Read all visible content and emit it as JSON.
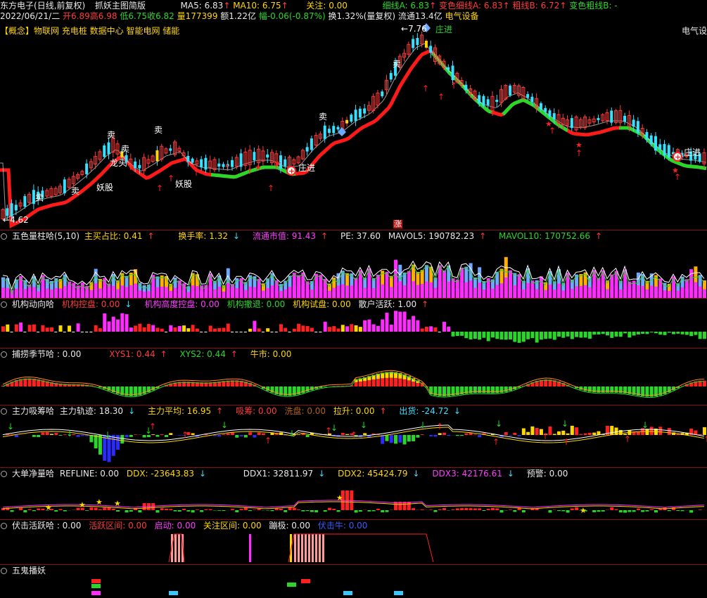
{
  "header": {
    "stock_name": "东方电子",
    "period": "(日线,前复权)",
    "indicator": "抓妖主图简版",
    "ma5": "MA5: 6.83",
    "ma10": "MA10: 6.75",
    "focus": "关注: 0.00",
    "thin_a": "细线A: 6.83",
    "thin_b": "变色细线A: 6.83",
    "thick_b": "粗线B: 6.72",
    "thick_c": "变色粗线B: -",
    "date": "2022/06/21/二",
    "open": "开6.89",
    "high": "高6.98",
    "low": "低6.75",
    "close": "收6.82",
    "volume": "量177399",
    "amount": "额1.22亿",
    "change": "幅-0.06(-0.87%)",
    "turnover": "换1.32%(量复权)",
    "float_cap": "流通13.4亿",
    "sector": "电气设备"
  },
  "concept": {
    "tag": "【概念】",
    "items": "物联网 充电桩 数据中心 智能电网 储能",
    "sector_right": "电气设"
  },
  "main_chart": {
    "price_high_label": "7.76",
    "price_low_label": "4.62",
    "high_arrow": "←",
    "low_arrow": "←",
    "zhang_label": "涨",
    "annotations": {
      "sell": "卖",
      "dragon": "龙头",
      "demon": "妖股",
      "zhuangjin": "庄进"
    }
  },
  "panel_volume": {
    "title": "五色量柱哈(5,10)",
    "buy_ratio": "主买占比: 0.41",
    "turnover": "换手率: 1.32",
    "float_value": "流通市值: 91.43",
    "pe": "PE: 37.60",
    "mavol5": "MAVOL5: 190782.23",
    "mavol10": "MAVOL10: 170752.66"
  },
  "panel_inst": {
    "title": "机构动向哈",
    "control": "机构控盘: 0.00",
    "high_control": "机构高度控盘: 0.00",
    "retreat": "机构撤退: 0.00",
    "trial": "机构试盘: 0.00",
    "retail": "散户活跃: 1.00"
  },
  "panel_season": {
    "title": "捕捞季节哈 : 0.00",
    "xys1": "XYS1: 0.44",
    "xys2": "XYS2: 0.44",
    "bull": "牛市: 0.00"
  },
  "panel_main": {
    "title": "主力吸筹哈",
    "track": "主力轨迹: 18.30",
    "avg": "主力平均: 16.95",
    "absorb": "吸筹: 0.00",
    "wash": "洗盘: 0.00",
    "pull": "拉升: 0.00",
    "ship": "出货: -24.72"
  },
  "panel_ddx": {
    "title": "大单净量哈",
    "refline": "REFLINE: 0.00",
    "ddx": "DDX: -23643.83",
    "ddx1": "DDX1: 32811.97",
    "ddx2": "DDX2: 45424.79",
    "ddx3": "DDX3: 42176.61",
    "warn": "预警: 0.00"
  },
  "panel_ambush": {
    "title": "伏击活跃哈 : 0.00",
    "active": "活跃区间: 0.00",
    "start": "启动: 0.00",
    "focus": "关注区间: 0.00",
    "hidden": "蹦极: 0.00",
    "ambush_bull": "伏击牛: 0.00"
  },
  "panel_ghost": {
    "title": "五鬼播妖"
  },
  "colors": {
    "up": "#ff3b3b",
    "down": "#38e0ff",
    "ma_red": "#ff1a1a",
    "ma_green": "#2bd62b",
    "separator": "#8a1010"
  }
}
